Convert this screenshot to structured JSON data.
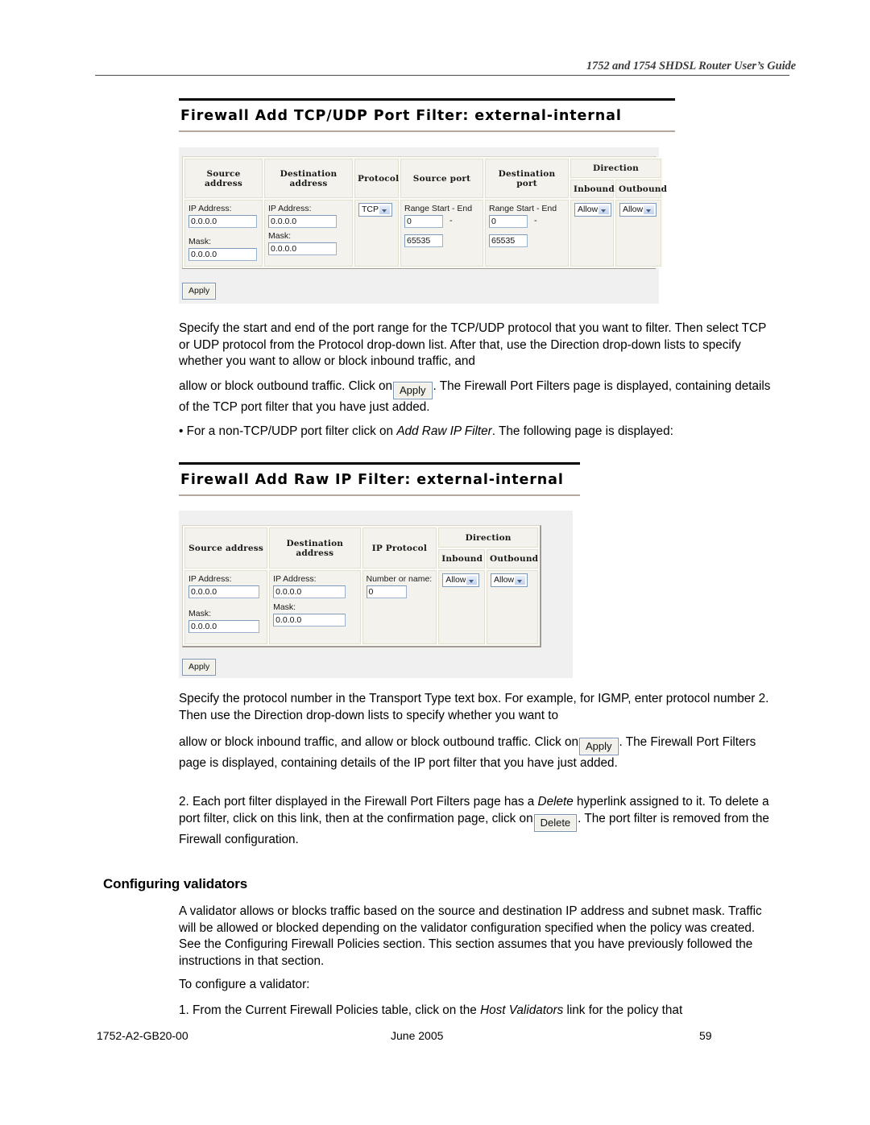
{
  "page": {
    "running_head": "1752 and 1754 SHDSL Router User’s Guide",
    "footer_left": "1752-A2-GB20-00",
    "footer_center": "June 2005",
    "footer_right": "59"
  },
  "screen1": {
    "heading": "Firewall Add TCP/UDP Port Filter: external-internal",
    "table": {
      "headers": {
        "source_address": "Source address",
        "destination_address": "Destination address",
        "protocol": "Protocol",
        "source_port": "Source port",
        "destination_port": "Destination port",
        "direction": "Direction",
        "inbound": "Inbound",
        "outbound": "Outbound"
      },
      "row": {
        "src_ip_label": "IP Address:",
        "src_ip_value": "0.0.0.0",
        "src_mask_label": "Mask:",
        "src_mask_value": "0.0.0.0",
        "dst_ip_label": "IP Address:",
        "dst_ip_value": "0.0.0.0",
        "dst_mask_label": "Mask:",
        "dst_mask_value": "0.0.0.0",
        "protocol_value": "TCP",
        "src_range_label": "Range Start - End",
        "src_range_start": "0",
        "src_range_sep": "-",
        "src_range_end": "65535",
        "dst_range_label": "Range Start - End",
        "dst_range_start": "0",
        "dst_range_sep": "-",
        "dst_range_end": "65535",
        "inbound_value": "Allow",
        "outbound_value": "Allow"
      }
    },
    "apply_label": "Apply"
  },
  "screen2": {
    "heading": "Firewall Add Raw IP Filter: external-internal",
    "table": {
      "headers": {
        "source_address": "Source address",
        "destination_address": "Destination address",
        "ip_protocol": "IP Protocol",
        "direction": "Direction",
        "inbound": "Inbound",
        "outbound": "Outbound"
      },
      "row": {
        "src_ip_label": "IP Address:",
        "src_ip_value": "0.0.0.0",
        "src_mask_label": "Mask:",
        "src_mask_value": "0.0.0.0",
        "dst_ip_label": "IP Address:",
        "dst_ip_value": "0.0.0.0",
        "dst_mask_label": "Mask:",
        "dst_mask_value": "0.0.0.0",
        "proto_label": "Number or name:",
        "proto_value": "0",
        "inbound_value": "Allow",
        "outbound_value": "Allow"
      }
    },
    "apply_label": "Apply"
  },
  "body": {
    "para1_a": "Specify the start and end of the port range for the TCP/UDP protocol that you want to filter. Then select TCP or UDP protocol from the Protocol drop-down list. After that, use the Direction drop-down lists to specify whether you want to allow or block inbound traffic, and",
    "para1_b": "allow or block outbound traffic. Click on",
    "para1_btn": "Apply",
    "para1_c": ". The Firewall Port Filters page is displayed, containing details of the TCP port filter that you have just added.",
    "bullet1_a": "• For a non-TCP/UDP port filter click on ",
    "bullet1_em": "Add Raw IP Filter",
    "bullet1_b": ". The following page is displayed:",
    "para2_a": "Specify the protocol number in the Transport Type text box. For example, for IGMP, enter protocol number 2. Then use the Direction drop-down lists to specify whether you want to",
    "para2_b": "allow or block inbound traffic, and allow or block outbound traffic. Click on",
    "para2_btn": "Apply",
    "para2_c": ". The Firewall Port Filters page is displayed, containing details of the IP port filter that you have just added.",
    "para3_a": "2. Each port filter displayed in the Firewall Port Filters page has a ",
    "para3_em": "Delete",
    "para3_b": " hyperlink assigned to it. To delete a port filter, click on this link, then at the confirmation page, click on",
    "para3_btn": "Delete",
    "para3_c": ". The port filter is removed from the Firewall configuration.",
    "section_title": "Configuring validators",
    "para4": "A validator allows or blocks traffic based on the source and destination IP address and subnet mask. Traffic will be allowed or blocked depending on the validator configuration specified when the policy was created. See the Configuring Firewall Policies section. This section assumes that you have previously followed the instructions in that section.",
    "para5": "To configure a validator:",
    "para6_a": "1. From the Current Firewall Policies table, click on the ",
    "para6_em": "Host Validators",
    "para6_b": " link for the policy that"
  }
}
